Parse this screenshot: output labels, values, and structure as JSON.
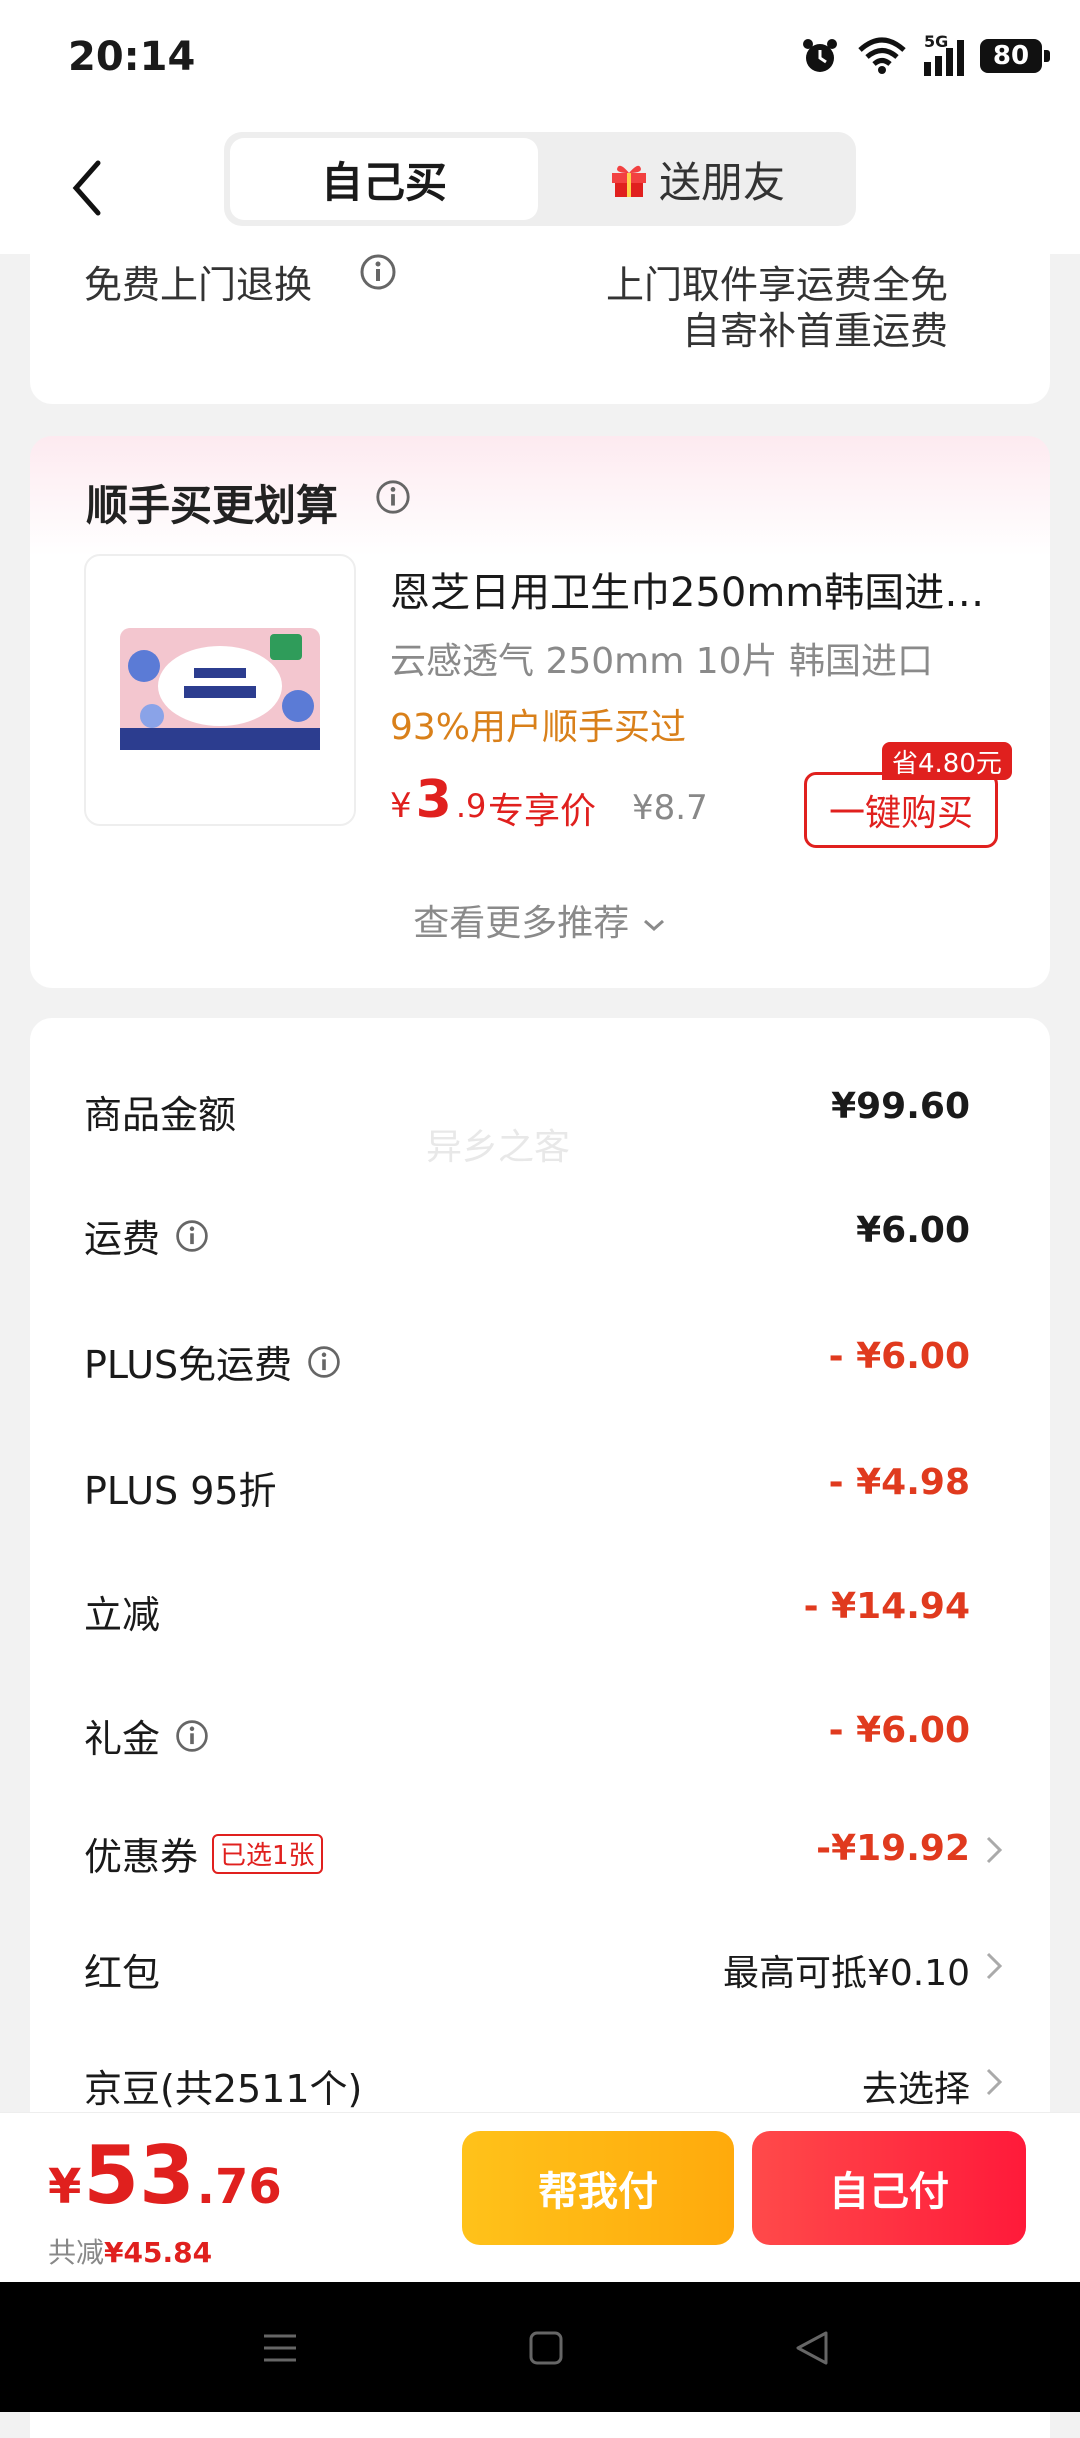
{
  "status_bar": {
    "time": "20:14",
    "battery": "80",
    "network": "5G"
  },
  "header": {
    "tab_self": "自己买",
    "tab_gift": "送朋友"
  },
  "returns": {
    "label": "免费上门退换",
    "line1": "上门取件享运费全免",
    "line2": "自寄补首重运费"
  },
  "recommend": {
    "title": "顺手买更划算",
    "product": {
      "name": "恩芝日用卫生巾250mm韩国进…",
      "subtitle": "云感透气 250mm 10片 韩国进口",
      "social": "93%用户顺手买过",
      "price_yen": "¥",
      "price_int": "3",
      "price_dec": ".9",
      "price_tag": "专享价",
      "original_price": "¥8.7",
      "save_badge": "省4.80元",
      "buy_label": "一键购买"
    },
    "more": "查看更多推荐"
  },
  "summary": {
    "watermark": "异乡之客",
    "rows": [
      {
        "label": "商品金额",
        "value": "¥99.60"
      },
      {
        "label": "运费",
        "value": "¥6.00"
      },
      {
        "label": "PLUS免运费",
        "value": "- ¥6.00"
      },
      {
        "label": "PLUS 95折",
        "value": "- ¥4.98"
      },
      {
        "label": "立减",
        "value": "- ¥14.94"
      },
      {
        "label": "礼金",
        "value": "- ¥6.00"
      },
      {
        "label": "优惠券",
        "badge": "已选1张",
        "value": "-¥19.92"
      },
      {
        "label": "红包",
        "value": "最高可抵¥0.10"
      },
      {
        "label": "京豆(共2511个)",
        "value": "去选择"
      }
    ]
  },
  "bottom_bar": {
    "total_yen": "¥",
    "total_int": "53",
    "total_dec": ".76",
    "total_save_prefix": "共减",
    "total_save_value": "¥45.84",
    "help_pay": "帮我付",
    "self_pay": "自己付"
  },
  "colors": {
    "accent_red": "#e0201e",
    "help_btn": "#ffb514",
    "self_btn": "#ff2a40"
  }
}
